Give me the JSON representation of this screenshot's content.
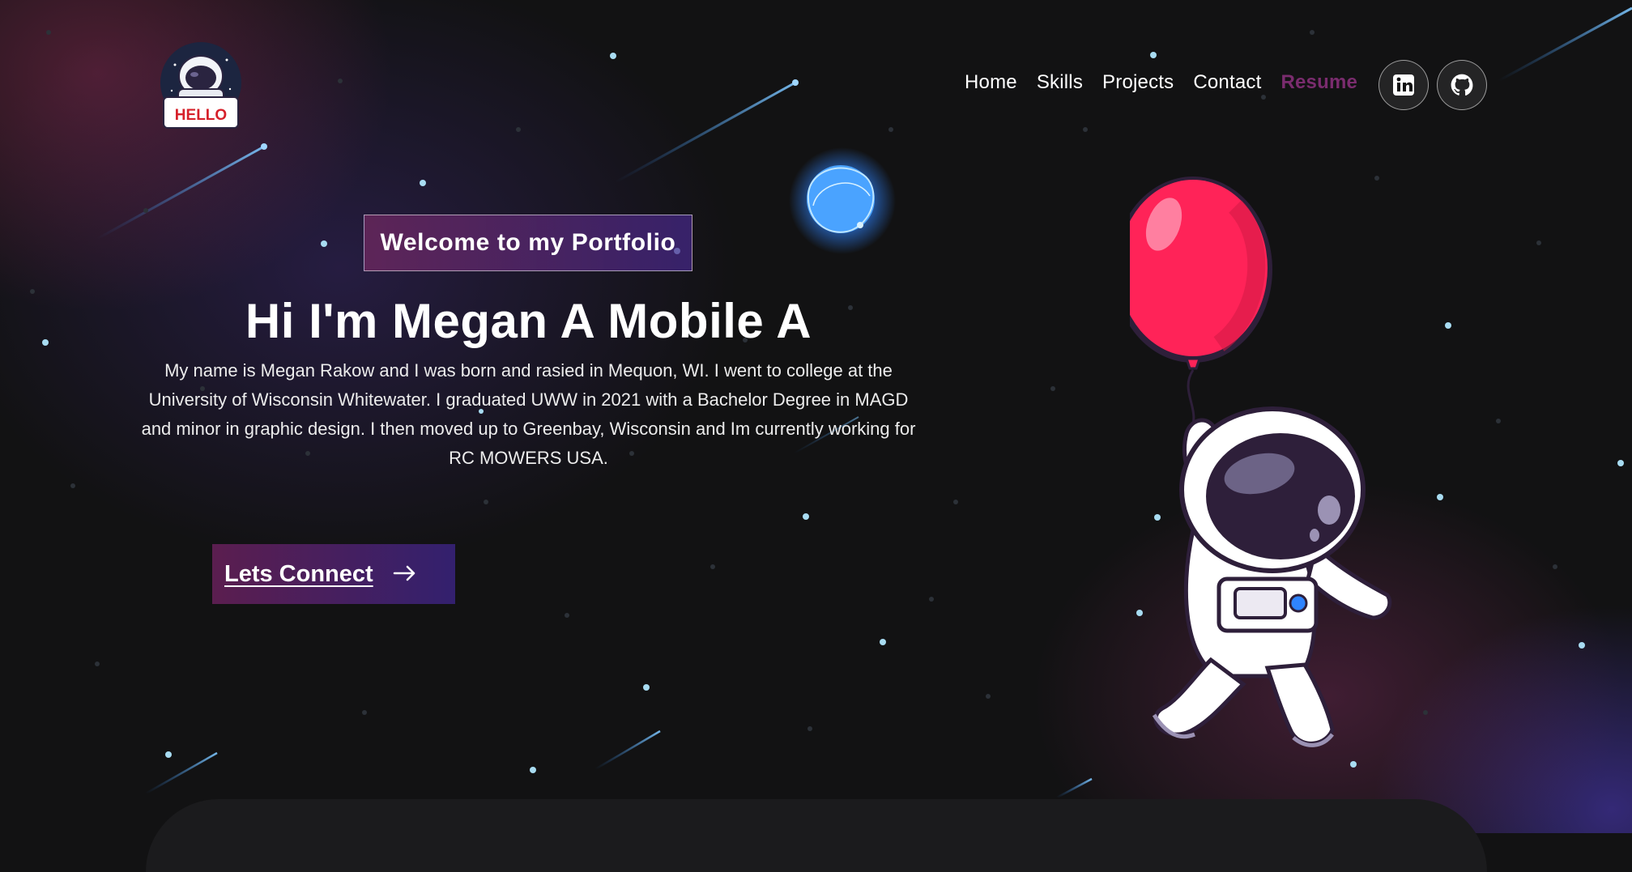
{
  "header": {
    "logo": {
      "badge_text": "HELLO",
      "icon": "astronaut-hello-logo"
    },
    "nav": [
      {
        "label": "Home"
      },
      {
        "label": "Skills"
      },
      {
        "label": "Projects"
      },
      {
        "label": "Contact"
      },
      {
        "label": "Resume"
      }
    ],
    "social": [
      {
        "icon": "linkedin-icon"
      },
      {
        "icon": "github-icon"
      }
    ]
  },
  "hero": {
    "tagline": "Welcome to my Portfolio",
    "headline": "Hi I'm Megan A Mobile A",
    "bio": "My name is Megan Rakow and I was born and rasied in Mequon, WI. I went to college at the University of Wisconsin Whitewater. I graduated UWW in 2021 with a Bachelor Degree in MAGD and minor in graphic design. I then moved up to Greenbay, Wisconsin and Im currently working for RC MOWERS USA.",
    "cta_label": "Lets Connect",
    "cta_icon": "arrow-right-icon"
  },
  "colors": {
    "background": "#121213",
    "resume_link": "#7a2c6e",
    "cta_gradient_start": "#5b1e4f",
    "cta_gradient_end": "#33206e",
    "balloon": "#ff2358"
  }
}
